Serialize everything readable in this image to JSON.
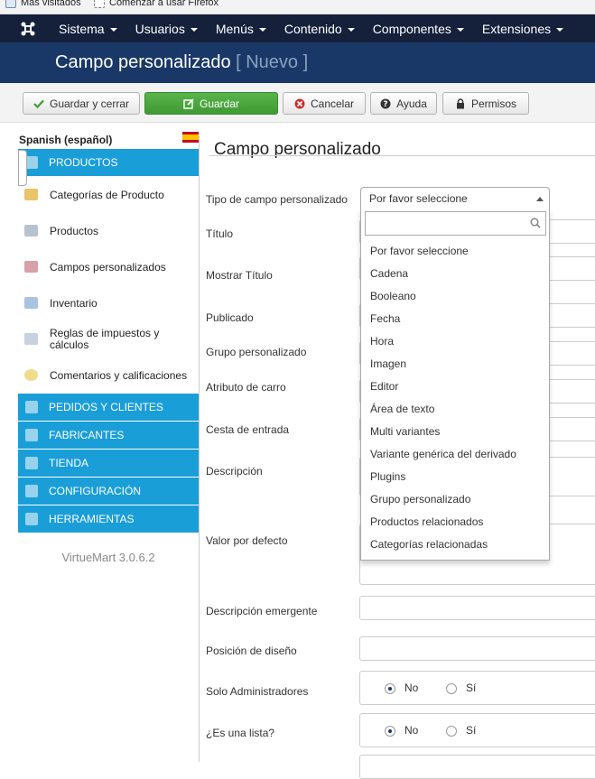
{
  "bookmarks": [
    "Más visitados",
    "Comenzar a usar Firefox"
  ],
  "topnav": {
    "menus": [
      "Sistema",
      "Usuarios",
      "Menús",
      "Contenido",
      "Componentes",
      "Extensiones"
    ]
  },
  "title": {
    "main": "Campo personalizado",
    "sub": "[ Nuevo ]"
  },
  "toolbar": {
    "save_close": "Guardar y cerrar",
    "save": "Guardar",
    "cancel": "Cancelar",
    "help": "Ayuda",
    "permissions": "Permisos"
  },
  "sidebar": {
    "language": "Spanish (español)",
    "sections": [
      "PRODUCTOS",
      "PEDIDOS Y CLIENTES",
      "FABRICANTES",
      "TIENDA",
      "CONFIGURACIÓN",
      "HERRAMIENTAS"
    ],
    "items": [
      "Categorías de Producto",
      "Productos",
      "Campos personalizados",
      "Inventario",
      "Reglas de impuestos y cálculos",
      "Comentarios y calificaciones"
    ],
    "version": "VirtueMart 3.0.6.2"
  },
  "form": {
    "heading": "Campo personalizado",
    "labels": [
      "Tipo de campo personalizado",
      "Título",
      "Mostrar Título",
      "Publicado",
      "Grupo personalizado",
      "Atributo de carro",
      "Cesta de entrada",
      "Descripción",
      "Valor por defecto",
      "Descripción emergente",
      "Posición de diseño",
      "Solo Administradores",
      "¿Es una lista?"
    ],
    "radio_no": "No",
    "radio_yes": "Sí"
  },
  "select": {
    "value": "Por favor seleccione",
    "options": [
      "Por favor seleccione",
      "Cadena",
      "Booleano",
      "Fecha",
      "Hora",
      "Imagen",
      "Editor",
      "Área de texto",
      "Multi variantes",
      "Variante genérica del derivado",
      "Plugins",
      "Grupo personalizado",
      "Productos relacionados",
      "Categorías relacionadas"
    ]
  },
  "colors": {
    "nav": "#15213b",
    "title": "#1a3867",
    "sidebar_accent": "#1a9ed8",
    "save_green": "#3f9a33"
  }
}
